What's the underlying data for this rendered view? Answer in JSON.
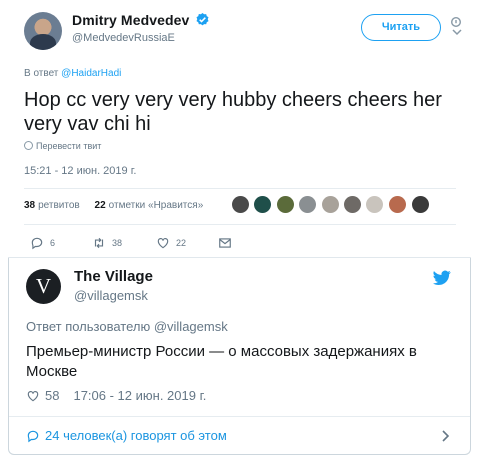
{
  "tweet": {
    "author_name": "Dmitry Medvedev",
    "author_handle": "@MedvedevRussiaE",
    "follow_label": "Читать",
    "reply_prefix": "В ответ",
    "reply_mention": "@HaidarHadi",
    "text": "Hop cc very very very hubby cheers cheers her very vav chi hi",
    "translate_label": "Перевести твит",
    "timestamp": "15:21 - 12 июн. 2019 г.",
    "retweets_count": "38",
    "retweets_label": "ретвитов",
    "likes_count": "22",
    "likes_label": "отметки «Нравится»",
    "actions": {
      "replies": "6",
      "retweets": "38",
      "likes": "22"
    },
    "icons": [
      "verified-badge-icon",
      "caret-down-icon",
      "globe-icon",
      "reply-icon",
      "retweet-icon",
      "heart-icon",
      "message-icon"
    ]
  },
  "quoted": {
    "avatar_letter": "V",
    "author_name": "The Village",
    "author_handle": "@villagemsk",
    "reply_line": "Ответ пользователю @villagemsk",
    "text": "Премьер-министр России — о массовых задержаниях в Москве",
    "likes": "58",
    "timestamp": "17:06 - 12 июн. 2019 г.",
    "conversation_label": "24 человек(а) говорят об этом",
    "icons": [
      "twitter-bird-icon",
      "heart-icon",
      "speech-bubble-icon",
      "chevron-right-icon"
    ]
  },
  "colors": {
    "accent": "#1da1f2",
    "muted": "#657786",
    "text": "#14171a",
    "divider": "#e6ecf0"
  }
}
